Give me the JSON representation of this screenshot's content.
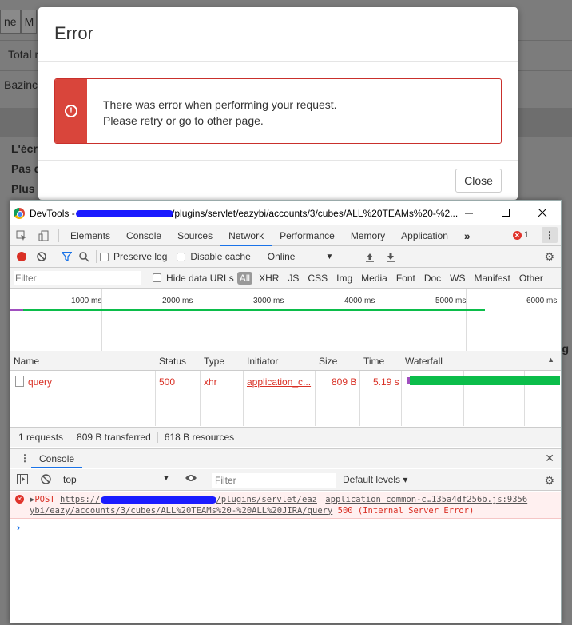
{
  "background": {
    "tabs": [
      "ne",
      "M"
    ],
    "rows": [
      "Total re",
      "Bazinc",
      "L'écra",
      "Pas d",
      "Plus"
    ],
    "right_fragment": "g"
  },
  "modal": {
    "title": "Error",
    "message_line1": "There was error when performing your request.",
    "message_line2": "Please retry or go to other page.",
    "close_label": "Close"
  },
  "devtools": {
    "window_title_prefix": "DevTools - ",
    "window_title_suffix": "/plugins/servlet/eazybi/accounts/3/cubes/ALL%20TEAMs%20-%2...",
    "tabs": [
      "Elements",
      "Console",
      "Sources",
      "Network",
      "Performance",
      "Memory",
      "Application"
    ],
    "active_tab": "Network",
    "more_tabs": "»",
    "error_count": "1",
    "network_toolbar": {
      "preserve_log": "Preserve log",
      "disable_cache": "Disable cache",
      "throttling": "Online"
    },
    "filter": {
      "placeholder": "Filter",
      "hide_data_urls": "Hide data URLs",
      "types": [
        "All",
        "XHR",
        "JS",
        "CSS",
        "Img",
        "Media",
        "Font",
        "Doc",
        "WS",
        "Manifest",
        "Other"
      ]
    },
    "overview_ticks": [
      "1000 ms",
      "2000 ms",
      "3000 ms",
      "4000 ms",
      "5000 ms",
      "6000 ms"
    ],
    "columns": [
      "Name",
      "Status",
      "Type",
      "Initiator",
      "Size",
      "Time",
      "Waterfall"
    ],
    "requests": [
      {
        "name": "query",
        "status": "500",
        "type": "xhr",
        "initiator": "application_c...",
        "size": "809 B",
        "time": "5.19 s"
      }
    ],
    "summary": {
      "requests": "1 requests",
      "transferred": "809 B transferred",
      "resources": "618 B resources"
    },
    "drawer_tab": "Console",
    "console_toolbar": {
      "context": "top",
      "filter_placeholder": "Filter",
      "levels": "Default levels ▾"
    },
    "console_message": {
      "method": "POST",
      "url_prefix": "https://",
      "url_part1": "/plugins/servlet/eaz",
      "source": "application_common-c…135a4df256b.js:9356",
      "url_part2": "ybi/eazy/accounts/3/cubes/ALL%20TEAMs%20-%20ALL%20JIRA/query",
      "status": "500 (Internal Server Error)"
    },
    "prompt": "›"
  }
}
